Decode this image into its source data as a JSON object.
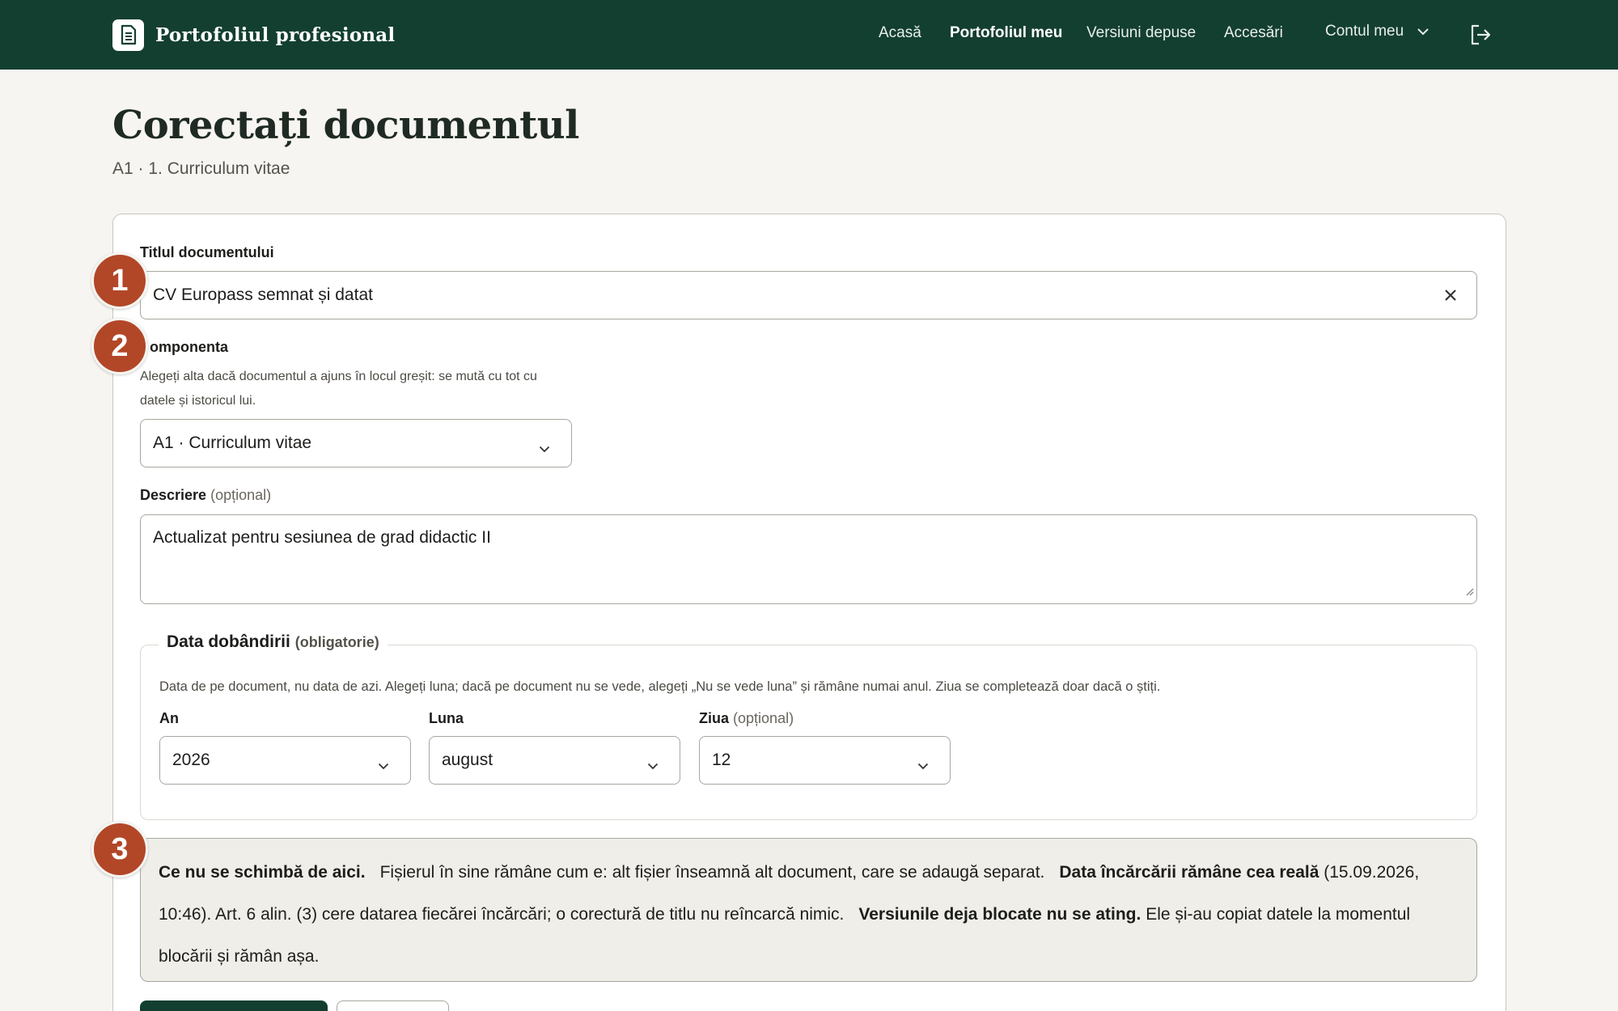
{
  "header": {
    "brand": "Portofoliul profesional",
    "nav": [
      "Acasă",
      "Portofoliul meu",
      "Versiuni depuse",
      "Accesări"
    ],
    "active_nav": "Portofoliul meu",
    "account": "Contul meu"
  },
  "page": {
    "title": "Corectați documentul",
    "subtitle": "A1 · 1. Curriculum vitae"
  },
  "form": {
    "title_label": "Titlul documentului",
    "title_value": "CV Europass semnat și datat",
    "component_label": "omponenta",
    "component_hint_1": "Alegeți alta dacă documentul a ajuns în locul greșit: se mută cu tot cu",
    "component_hint_2": "datele și istoricul lui.",
    "component_value": "A1 · Curriculum vitae",
    "description_label": "Descriere",
    "description_optional": "(opțional)",
    "description_value": "Actualizat pentru sesiunea de grad didactic II",
    "date": {
      "legend": "Data dobândirii",
      "legend_required": "(obligatorie)",
      "hint": "Data de pe document, nu data de azi. Alegeți luna; dacă pe document nu se vede, alegeți „Nu se vede luna” și rămâne numai anul. Ziua se completează doar dacă o știți.",
      "year_label": "An",
      "year_value": "2026",
      "month_label": "Luna",
      "month_value": "august",
      "day_label": "Ziua",
      "day_optional": "(opțional)",
      "day_value": "12"
    },
    "note": {
      "b1": "Ce nu se schimbă de aici.",
      "t1": "Fișierul în sine rămâne cum e: alt fișier înseamnă alt document, care se adaugă separat.",
      "b2": "Data încărcării rămâne cea reală",
      "t2": "(15.09.2026, 10:46). Art. 6 alin. (3) cere datarea fiecărei încărcări; o corectură de titlu nu reîncarcă nimic.",
      "b3": "Versiunile deja blocate nu se ating.",
      "t3": "Ele și-au copiat datele la momentul blocării și rămân așa."
    }
  },
  "badges": [
    "1",
    "2",
    "3"
  ],
  "colors": {
    "header": "#133f31",
    "badge": "#b24728",
    "background": "#f6f5f1"
  }
}
